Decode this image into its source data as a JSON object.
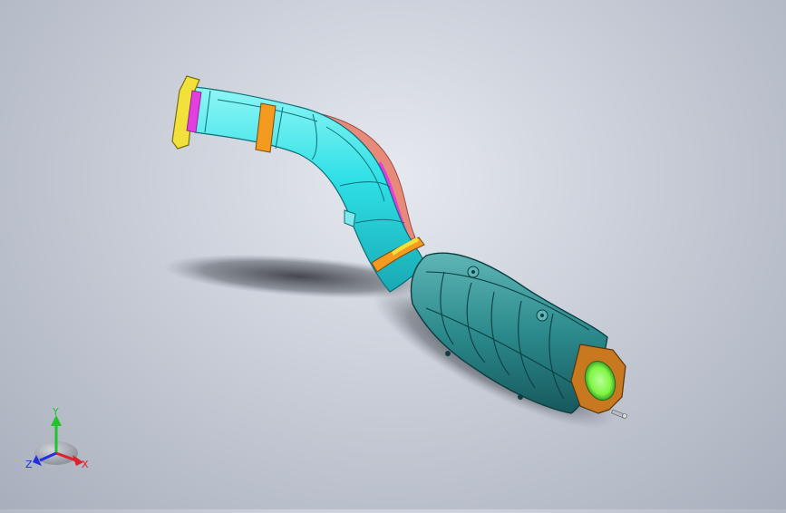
{
  "viewport": {
    "background_top": "#e6e9ef",
    "background_bottom": "#a8afbc"
  },
  "model": {
    "pipe_color": "#2fe0e6",
    "clamp_color": "#f39a1f",
    "flange_color": "#f1e13a",
    "gasket_color": "#e23fe0",
    "heatshield_color": "#e88a7a",
    "converter_color": "#2b8a8c",
    "outlet_flange_color": "#c8781f",
    "outlet_bore_color": "#7ef542"
  },
  "triad": {
    "x_label": "X",
    "y_label": "Y",
    "z_label": "Z",
    "x_color": "#e0202a",
    "y_color": "#22c22a",
    "z_color": "#2030e0"
  }
}
